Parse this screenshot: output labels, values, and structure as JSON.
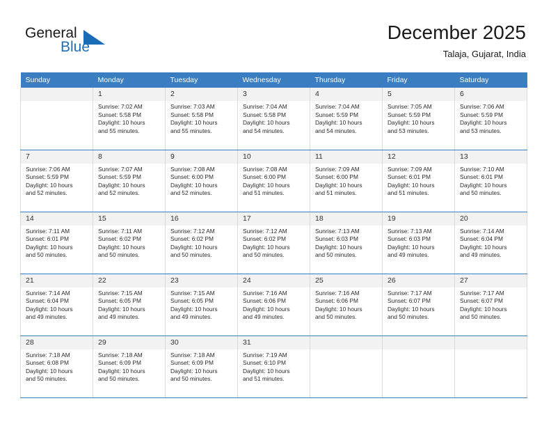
{
  "brand": {
    "name_part1": "General",
    "name_part2": "Blue",
    "triangle_color": "#1a6db5",
    "blue": "#1d6fb8"
  },
  "header": {
    "title": "December 2025",
    "subtitle": "Talaja, Gujarat, India"
  },
  "theme": {
    "header_row_bg": "#3a7dc0",
    "daynum_bg": "#f2f2f2",
    "grid_line": "#d9d9d9",
    "week_divider": "#3a7dc0"
  },
  "weekdays": [
    "Sunday",
    "Monday",
    "Tuesday",
    "Wednesday",
    "Thursday",
    "Friday",
    "Saturday"
  ],
  "weeks": [
    [
      {
        "day": "",
        "lines": []
      },
      {
        "day": "1",
        "lines": [
          "Sunrise: 7:02 AM",
          "Sunset: 5:58 PM",
          "Daylight: 10 hours",
          "and 55 minutes."
        ]
      },
      {
        "day": "2",
        "lines": [
          "Sunrise: 7:03 AM",
          "Sunset: 5:58 PM",
          "Daylight: 10 hours",
          "and 55 minutes."
        ]
      },
      {
        "day": "3",
        "lines": [
          "Sunrise: 7:04 AM",
          "Sunset: 5:58 PM",
          "Daylight: 10 hours",
          "and 54 minutes."
        ]
      },
      {
        "day": "4",
        "lines": [
          "Sunrise: 7:04 AM",
          "Sunset: 5:59 PM",
          "Daylight: 10 hours",
          "and 54 minutes."
        ]
      },
      {
        "day": "5",
        "lines": [
          "Sunrise: 7:05 AM",
          "Sunset: 5:59 PM",
          "Daylight: 10 hours",
          "and 53 minutes."
        ]
      },
      {
        "day": "6",
        "lines": [
          "Sunrise: 7:06 AM",
          "Sunset: 5:59 PM",
          "Daylight: 10 hours",
          "and 53 minutes."
        ]
      }
    ],
    [
      {
        "day": "7",
        "lines": [
          "Sunrise: 7:06 AM",
          "Sunset: 5:59 PM",
          "Daylight: 10 hours",
          "and 52 minutes."
        ]
      },
      {
        "day": "8",
        "lines": [
          "Sunrise: 7:07 AM",
          "Sunset: 5:59 PM",
          "Daylight: 10 hours",
          "and 52 minutes."
        ]
      },
      {
        "day": "9",
        "lines": [
          "Sunrise: 7:08 AM",
          "Sunset: 6:00 PM",
          "Daylight: 10 hours",
          "and 52 minutes."
        ]
      },
      {
        "day": "10",
        "lines": [
          "Sunrise: 7:08 AM",
          "Sunset: 6:00 PM",
          "Daylight: 10 hours",
          "and 51 minutes."
        ]
      },
      {
        "day": "11",
        "lines": [
          "Sunrise: 7:09 AM",
          "Sunset: 6:00 PM",
          "Daylight: 10 hours",
          "and 51 minutes."
        ]
      },
      {
        "day": "12",
        "lines": [
          "Sunrise: 7:09 AM",
          "Sunset: 6:01 PM",
          "Daylight: 10 hours",
          "and 51 minutes."
        ]
      },
      {
        "day": "13",
        "lines": [
          "Sunrise: 7:10 AM",
          "Sunset: 6:01 PM",
          "Daylight: 10 hours",
          "and 50 minutes."
        ]
      }
    ],
    [
      {
        "day": "14",
        "lines": [
          "Sunrise: 7:11 AM",
          "Sunset: 6:01 PM",
          "Daylight: 10 hours",
          "and 50 minutes."
        ]
      },
      {
        "day": "15",
        "lines": [
          "Sunrise: 7:11 AM",
          "Sunset: 6:02 PM",
          "Daylight: 10 hours",
          "and 50 minutes."
        ]
      },
      {
        "day": "16",
        "lines": [
          "Sunrise: 7:12 AM",
          "Sunset: 6:02 PM",
          "Daylight: 10 hours",
          "and 50 minutes."
        ]
      },
      {
        "day": "17",
        "lines": [
          "Sunrise: 7:12 AM",
          "Sunset: 6:02 PM",
          "Daylight: 10 hours",
          "and 50 minutes."
        ]
      },
      {
        "day": "18",
        "lines": [
          "Sunrise: 7:13 AM",
          "Sunset: 6:03 PM",
          "Daylight: 10 hours",
          "and 50 minutes."
        ]
      },
      {
        "day": "19",
        "lines": [
          "Sunrise: 7:13 AM",
          "Sunset: 6:03 PM",
          "Daylight: 10 hours",
          "and 49 minutes."
        ]
      },
      {
        "day": "20",
        "lines": [
          "Sunrise: 7:14 AM",
          "Sunset: 6:04 PM",
          "Daylight: 10 hours",
          "and 49 minutes."
        ]
      }
    ],
    [
      {
        "day": "21",
        "lines": [
          "Sunrise: 7:14 AM",
          "Sunset: 6:04 PM",
          "Daylight: 10 hours",
          "and 49 minutes."
        ]
      },
      {
        "day": "22",
        "lines": [
          "Sunrise: 7:15 AM",
          "Sunset: 6:05 PM",
          "Daylight: 10 hours",
          "and 49 minutes."
        ]
      },
      {
        "day": "23",
        "lines": [
          "Sunrise: 7:15 AM",
          "Sunset: 6:05 PM",
          "Daylight: 10 hours",
          "and 49 minutes."
        ]
      },
      {
        "day": "24",
        "lines": [
          "Sunrise: 7:16 AM",
          "Sunset: 6:06 PM",
          "Daylight: 10 hours",
          "and 49 minutes."
        ]
      },
      {
        "day": "25",
        "lines": [
          "Sunrise: 7:16 AM",
          "Sunset: 6:06 PM",
          "Daylight: 10 hours",
          "and 50 minutes."
        ]
      },
      {
        "day": "26",
        "lines": [
          "Sunrise: 7:17 AM",
          "Sunset: 6:07 PM",
          "Daylight: 10 hours",
          "and 50 minutes."
        ]
      },
      {
        "day": "27",
        "lines": [
          "Sunrise: 7:17 AM",
          "Sunset: 6:07 PM",
          "Daylight: 10 hours",
          "and 50 minutes."
        ]
      }
    ],
    [
      {
        "day": "28",
        "lines": [
          "Sunrise: 7:18 AM",
          "Sunset: 6:08 PM",
          "Daylight: 10 hours",
          "and 50 minutes."
        ]
      },
      {
        "day": "29",
        "lines": [
          "Sunrise: 7:18 AM",
          "Sunset: 6:09 PM",
          "Daylight: 10 hours",
          "and 50 minutes."
        ]
      },
      {
        "day": "30",
        "lines": [
          "Sunrise: 7:18 AM",
          "Sunset: 6:09 PM",
          "Daylight: 10 hours",
          "and 50 minutes."
        ]
      },
      {
        "day": "31",
        "lines": [
          "Sunrise: 7:19 AM",
          "Sunset: 6:10 PM",
          "Daylight: 10 hours",
          "and 51 minutes."
        ]
      },
      {
        "day": "",
        "lines": []
      },
      {
        "day": "",
        "lines": []
      },
      {
        "day": "",
        "lines": []
      }
    ]
  ]
}
